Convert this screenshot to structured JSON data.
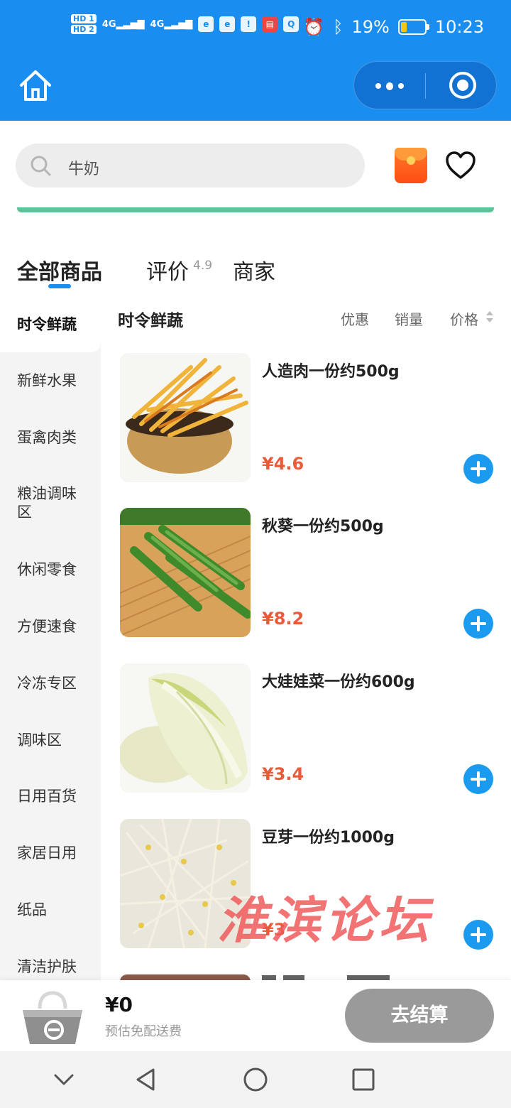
{
  "status_bar": {
    "hd1": "HD 1",
    "hd2": "HD 2",
    "signal1": "4G",
    "signal2": "4G",
    "more": "···",
    "battery_percent": "19%",
    "time": "10:23"
  },
  "header": {
    "home_icon": "home-icon",
    "more_icon": "more-dots-icon",
    "close_icon": "target-icon"
  },
  "search": {
    "placeholder": "牛奶"
  },
  "tabs": [
    {
      "label": "全部商品",
      "active": true
    },
    {
      "label": "评价",
      "rating": "4.9"
    },
    {
      "label": "商家"
    }
  ],
  "categories": [
    "时令鲜蔬",
    "新鲜水果",
    "蛋禽肉类",
    "粮油调味区",
    "休闲零食",
    "方便速食",
    "冷冻专区",
    "调味区",
    "日用百货",
    "家居日用",
    "纸品",
    "清洁护肤"
  ],
  "section": {
    "title": "时令鲜蔬",
    "sort_options": [
      "优惠",
      "销量",
      "价格"
    ]
  },
  "products": [
    {
      "name": "人造肉一份约500g",
      "price": "¥4.6"
    },
    {
      "name": "秋葵一份约500g",
      "price": "¥8.2"
    },
    {
      "name": "大娃娃菜一份约600g",
      "price": "¥3.4"
    },
    {
      "name": "豆芽一份约1000g",
      "price": "¥3"
    }
  ],
  "watermark": "淮滨论坛",
  "cart": {
    "total": "¥0",
    "note": "预估免配送费",
    "checkout_label": "去结算"
  },
  "colors": {
    "brand_blue": "#1a8ef0",
    "price_red": "#ea5b3a",
    "add_button": "#1a9bf0",
    "checkout_disabled": "#9a9a9a"
  }
}
